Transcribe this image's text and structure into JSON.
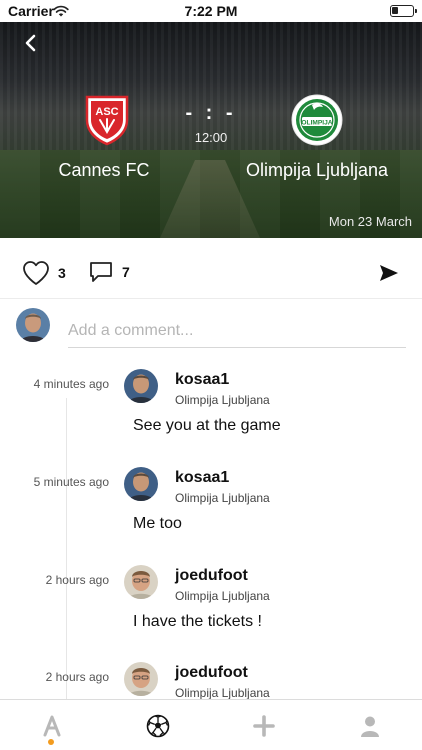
{
  "status_bar": {
    "carrier": "Carrier",
    "time": "7:22 PM",
    "battery_level": 0.3
  },
  "match": {
    "home_team": "Cannes FC",
    "away_team": "Olimpija Ljubljana",
    "score": "- : -",
    "kickoff": "12:00",
    "date": "Mon 23 March",
    "home_logo_text": "ASC",
    "away_logo_text": "OLIMPIJA"
  },
  "reactions": {
    "likes": "3",
    "comments": "7"
  },
  "composer": {
    "placeholder": "Add a comment..."
  },
  "comments": [
    {
      "time": "4 minutes ago",
      "user": "kosaa1",
      "team": "Olimpija Ljubljana",
      "text": "See you at the game"
    },
    {
      "time": "5 minutes ago",
      "user": "kosaa1",
      "team": "Olimpija Ljubljana",
      "text": "Me too"
    },
    {
      "time": "2 hours ago",
      "user": "joedufoot",
      "team": "Olimpija Ljubljana",
      "text": "I have the tickets !"
    },
    {
      "time": "2 hours ago",
      "user": "joedufoot",
      "team": "Olimpija Ljubljana",
      "text": ""
    }
  ],
  "icons": {
    "back": "chevron-left-icon",
    "like": "heart-icon",
    "comment": "speech-bubble-icon",
    "share": "send-icon",
    "tab_home": "app-logo-icon",
    "tab_match": "soccer-ball-icon",
    "tab_add": "plus-icon",
    "tab_profile": "user-icon"
  },
  "colors": {
    "accent": "#f39c1f",
    "home_red": "#d9262b",
    "away_green": "#1f8a3b"
  }
}
